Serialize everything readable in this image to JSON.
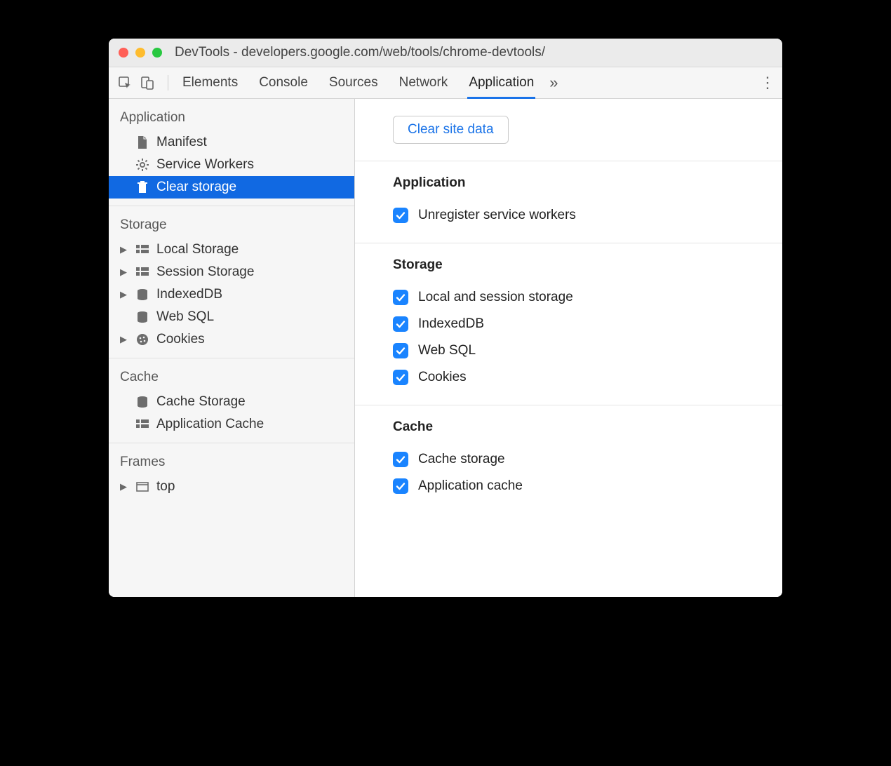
{
  "window": {
    "title": "DevTools - developers.google.com/web/tools/chrome-devtools/"
  },
  "toolbar": {
    "tabs": [
      "Elements",
      "Console",
      "Sources",
      "Network",
      "Application"
    ],
    "active_tab": "Application"
  },
  "sidebar": {
    "groups": [
      {
        "title": "Application",
        "items": [
          {
            "label": "Manifest",
            "icon": "file",
            "expandable": false,
            "selected": false
          },
          {
            "label": "Service Workers",
            "icon": "gear",
            "expandable": false,
            "selected": false
          },
          {
            "label": "Clear storage",
            "icon": "trash",
            "expandable": false,
            "selected": true
          }
        ]
      },
      {
        "title": "Storage",
        "items": [
          {
            "label": "Local Storage",
            "icon": "grid",
            "expandable": true,
            "selected": false
          },
          {
            "label": "Session Storage",
            "icon": "grid",
            "expandable": true,
            "selected": false
          },
          {
            "label": "IndexedDB",
            "icon": "db",
            "expandable": true,
            "selected": false
          },
          {
            "label": "Web SQL",
            "icon": "db",
            "expandable": false,
            "selected": false
          },
          {
            "label": "Cookies",
            "icon": "cookie",
            "expandable": true,
            "selected": false
          }
        ]
      },
      {
        "title": "Cache",
        "items": [
          {
            "label": "Cache Storage",
            "icon": "db",
            "expandable": false,
            "selected": false
          },
          {
            "label": "Application Cache",
            "icon": "grid",
            "expandable": false,
            "selected": false
          }
        ]
      },
      {
        "title": "Frames",
        "items": [
          {
            "label": "top",
            "icon": "frame",
            "expandable": true,
            "selected": false
          }
        ]
      }
    ]
  },
  "main": {
    "clear_button": "Clear site data",
    "sections": [
      {
        "title": "Application",
        "items": [
          {
            "label": "Unregister service workers",
            "checked": true
          }
        ]
      },
      {
        "title": "Storage",
        "items": [
          {
            "label": "Local and session storage",
            "checked": true
          },
          {
            "label": "IndexedDB",
            "checked": true
          },
          {
            "label": "Web SQL",
            "checked": true
          },
          {
            "label": "Cookies",
            "checked": true
          }
        ]
      },
      {
        "title": "Cache",
        "items": [
          {
            "label": "Cache storage",
            "checked": true
          },
          {
            "label": "Application cache",
            "checked": true
          }
        ]
      }
    ]
  }
}
